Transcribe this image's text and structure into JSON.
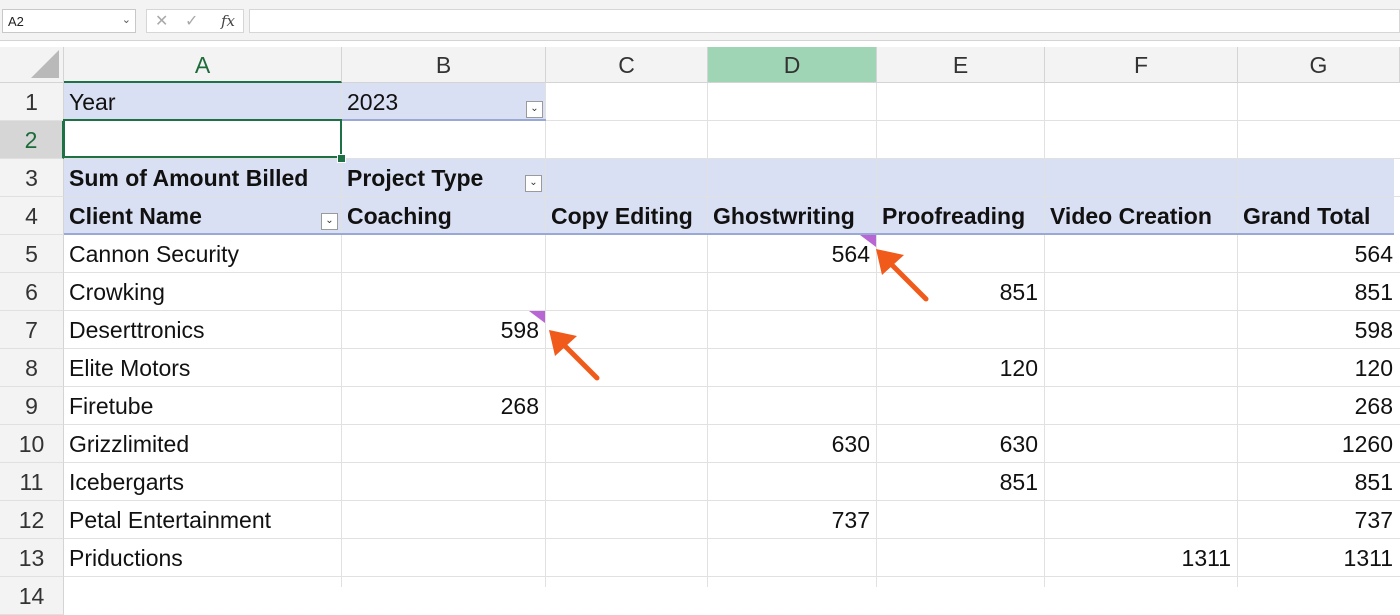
{
  "formula_bar": {
    "name_box": "A2",
    "cancel_glyph": "✕",
    "enter_glyph": "✓",
    "fx_label": "fx",
    "formula": ""
  },
  "columns": [
    "A",
    "B",
    "C",
    "D",
    "E",
    "F",
    "G"
  ],
  "active_column": "A",
  "selected_column": "D",
  "rows": [
    "1",
    "2",
    "3",
    "4",
    "5",
    "6",
    "7",
    "8",
    "9",
    "10",
    "11",
    "12",
    "13",
    "14"
  ],
  "active_row": "2",
  "filter": {
    "label": "Year",
    "value": "2023"
  },
  "pivot": {
    "values_label": "Sum of Amount Billed",
    "columns_label": "Project Type",
    "rows_label": "Client Name",
    "headers": [
      "Coaching",
      "Copy Editing",
      "Ghostwriting",
      "Proofreading",
      "Video Creation",
      "Grand Total"
    ],
    "data": [
      {
        "client": "Cannon Security",
        "values": [
          "",
          "",
          "564",
          "",
          "",
          "564"
        ]
      },
      {
        "client": "Crowking",
        "values": [
          "",
          "",
          "",
          "851",
          "",
          "851"
        ]
      },
      {
        "client": "Deserttronics",
        "values": [
          "598",
          "",
          "",
          "",
          "",
          "598"
        ]
      },
      {
        "client": "Elite Motors",
        "values": [
          "",
          "",
          "",
          "120",
          "",
          "120"
        ]
      },
      {
        "client": "Firetube",
        "values": [
          "268",
          "",
          "",
          "",
          "",
          "268"
        ]
      },
      {
        "client": "Grizzlimited",
        "values": [
          "",
          "",
          "630",
          "630",
          "",
          "1260"
        ]
      },
      {
        "client": "Icebergarts",
        "values": [
          "",
          "",
          "",
          "851",
          "",
          "851"
        ]
      },
      {
        "client": "Petal Entertainment",
        "values": [
          "",
          "",
          "737",
          "",
          "",
          "737"
        ]
      },
      {
        "client": "Priductions",
        "values": [
          "",
          "",
          "",
          "",
          "1311",
          "1311"
        ]
      }
    ]
  },
  "icons": {
    "filter_applied": "funnel-dropdown-icon",
    "dropdown": "chevron-down-icon"
  },
  "colors": {
    "pivot_header_band": "#dae0f3",
    "selection": "#1e7145",
    "comment_marker": "#b866d3",
    "arrow": "#f05a1a"
  }
}
